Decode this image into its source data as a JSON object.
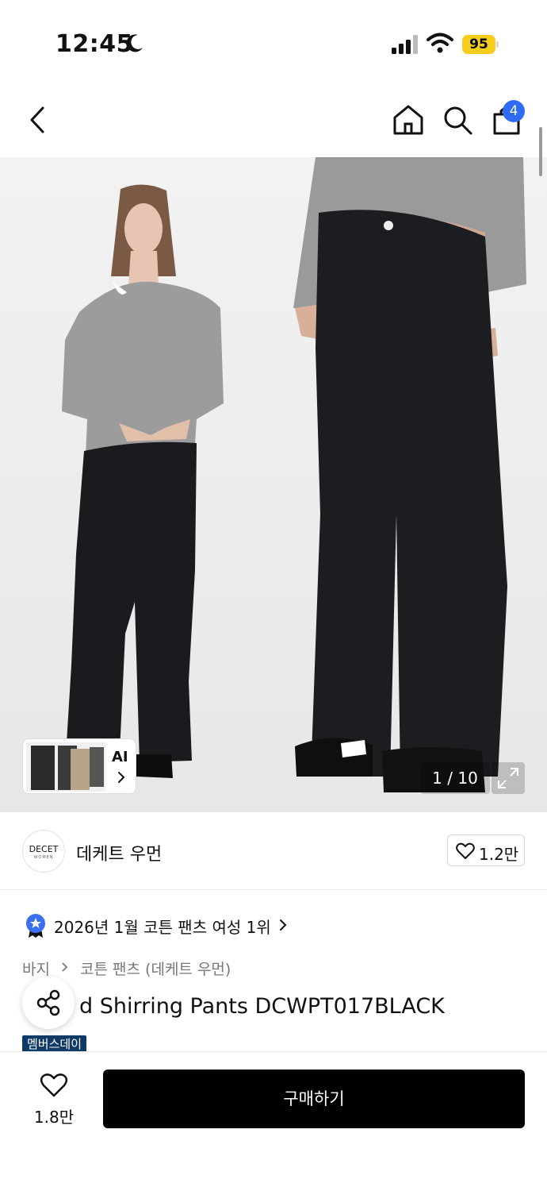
{
  "status_bar": {
    "time": "12:45",
    "battery": "95",
    "icons": [
      "moon-icon",
      "signal-icon",
      "wifi-icon",
      "battery-icon"
    ],
    "battery_color": "#f5cd1c"
  },
  "nav": {
    "icons": [
      "back-icon",
      "home-icon",
      "search-icon",
      "shopping-bag-icon"
    ],
    "cart_count": "4",
    "badge_color": "#2f6cf5"
  },
  "gallery": {
    "ai_label": "AI",
    "page_counter": "1 / 10"
  },
  "brand": {
    "logo_text": "DECET",
    "logo_subtext": "WOMEN",
    "name": "데케트 우먼",
    "like_count": "1.2만"
  },
  "rank": {
    "text": "2026년 1월 코튼 팬츠 여성 1위"
  },
  "breadcrumb": {
    "items": [
      "바지",
      "코튼 팬츠 (데케트 우먼)"
    ]
  },
  "product": {
    "title": "d Shirring Pants DCWPT017BLACK",
    "promo_tag": "멤버스데이",
    "promo_color": "#0f3a66"
  },
  "bottom_bar": {
    "wish_count": "1.8만",
    "buy_label": "구매하기"
  }
}
